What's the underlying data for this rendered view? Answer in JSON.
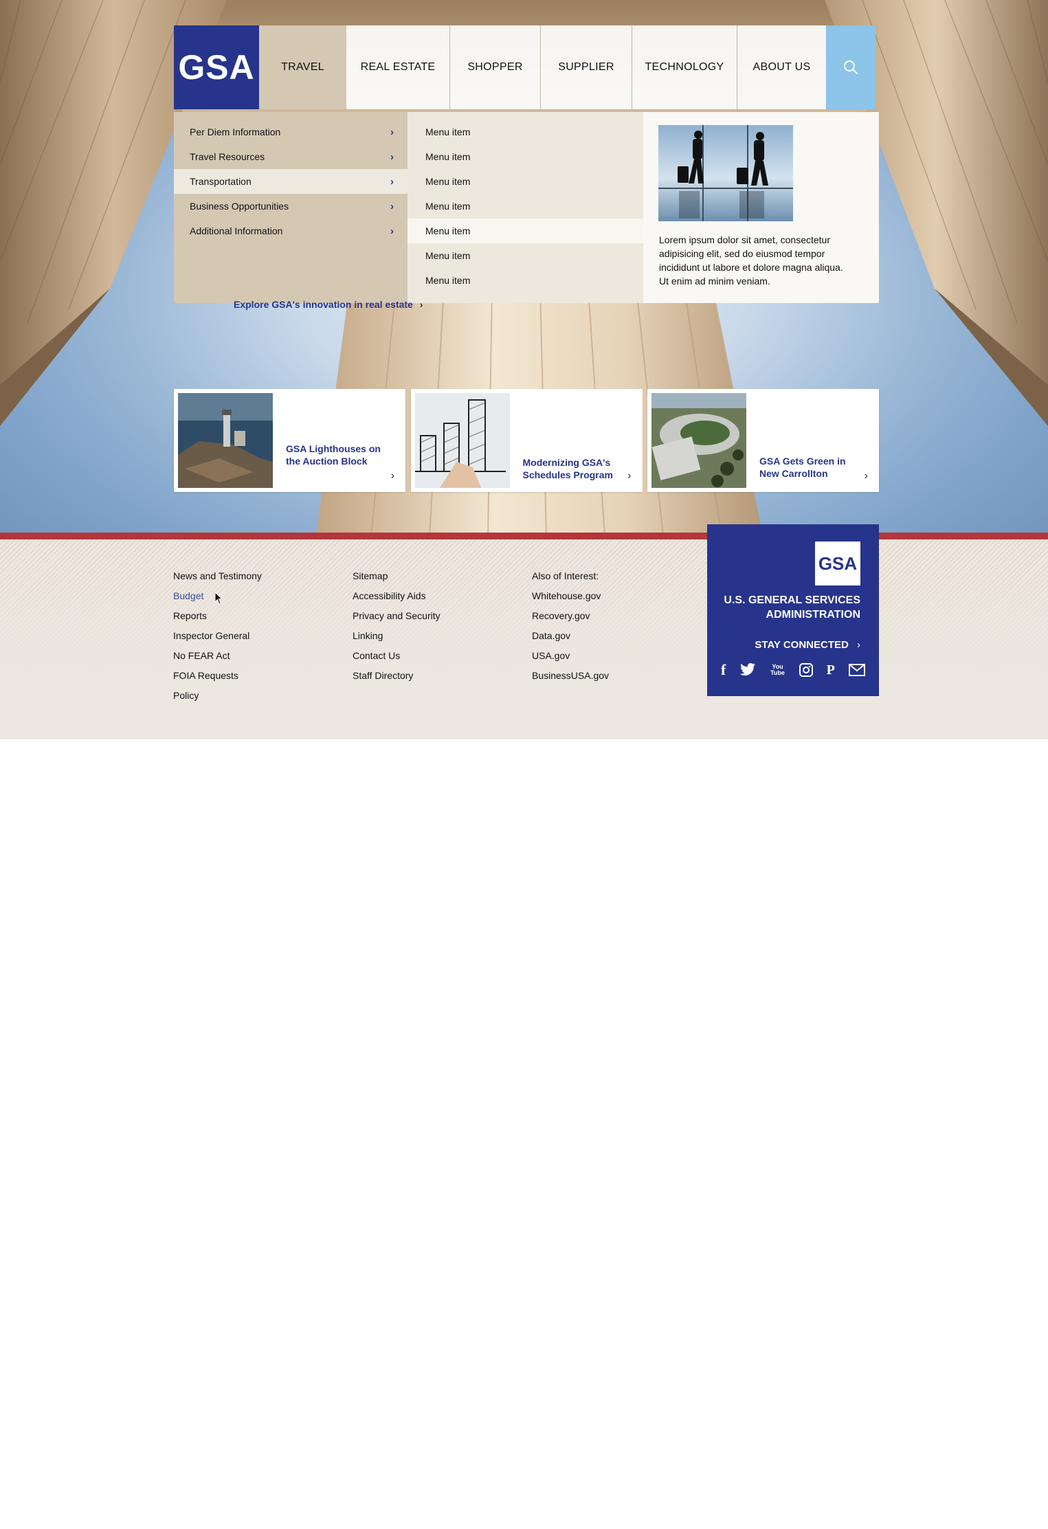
{
  "nav": {
    "logo": "GSA",
    "items": [
      {
        "label": "TRAVEL",
        "active": true
      },
      {
        "label": "REAL ESTATE"
      },
      {
        "label": "SHOPPER"
      },
      {
        "label": "SUPPLIER"
      },
      {
        "label": "TECHNOLOGY"
      },
      {
        "label": "ABOUT US"
      }
    ],
    "search_icon": "search-icon"
  },
  "mega_menu": {
    "sections": [
      {
        "label": "Per Diem Information",
        "icon": "chevron-right-icon"
      },
      {
        "label": "Travel Resources",
        "icon": "chevron-right-icon"
      },
      {
        "label": "Transportation",
        "icon": "chevron-right-icon",
        "selected": true
      },
      {
        "label": "Business Opportunities",
        "icon": "chevron-right-icon"
      },
      {
        "label": "Additional Information",
        "icon": "chevron-right-icon"
      }
    ],
    "items": [
      {
        "label": "Menu item"
      },
      {
        "label": "Menu item"
      },
      {
        "label": "Menu item"
      },
      {
        "label": "Menu item"
      },
      {
        "label": "Menu item",
        "selected": true
      },
      {
        "label": "Menu item"
      },
      {
        "label": "Menu item"
      }
    ],
    "promo_text": "Lorem ipsum dolor sit amet, consectetur adipisicing elit, sed do eiusmod tempor incididunt ut labore et dolore magna aliqua. Ut enim ad minim veniam."
  },
  "hero": {
    "explore_link": "Explore GSA's innovation in real estate"
  },
  "cards": [
    {
      "title": "GSA Lighthouses on the Auction Block"
    },
    {
      "title": "Modernizing GSA's Schedules Program"
    },
    {
      "title": "GSA Gets Green in New Carrollton"
    }
  ],
  "footer": {
    "col1": [
      "News and Testimony",
      "Budget",
      "Reports",
      "Inspector General",
      "No FEAR Act",
      "FOIA Requests",
      "Policy"
    ],
    "col2": [
      "Sitemap",
      "Accessibility Aids",
      "Privacy and Security",
      "Linking",
      "Contact Us",
      "Staff Directory"
    ],
    "col3": [
      "Also of Interest:",
      "Whitehouse.gov",
      "Recovery.gov",
      "Data.gov",
      "USA.gov",
      "BusinessUSA.gov"
    ],
    "agency_logo": "GSA",
    "agency_name_line1": "U.S. GENERAL SERVICES",
    "agency_name_line2": "ADMINISTRATION",
    "stay_connected": "STAY CONNECTED",
    "social_icons": [
      "facebook-icon",
      "twitter-icon",
      "youtube-icon",
      "instagram-icon",
      "pinterest-icon",
      "email-icon"
    ],
    "social_youtube_text": "You Tube"
  },
  "colors": {
    "brand_blue": "#27348b",
    "nav_active": "#d4c8b3",
    "search_blue": "#8cc4ea",
    "footer_red": "#b3363b",
    "footer_bg": "#ece7df"
  }
}
